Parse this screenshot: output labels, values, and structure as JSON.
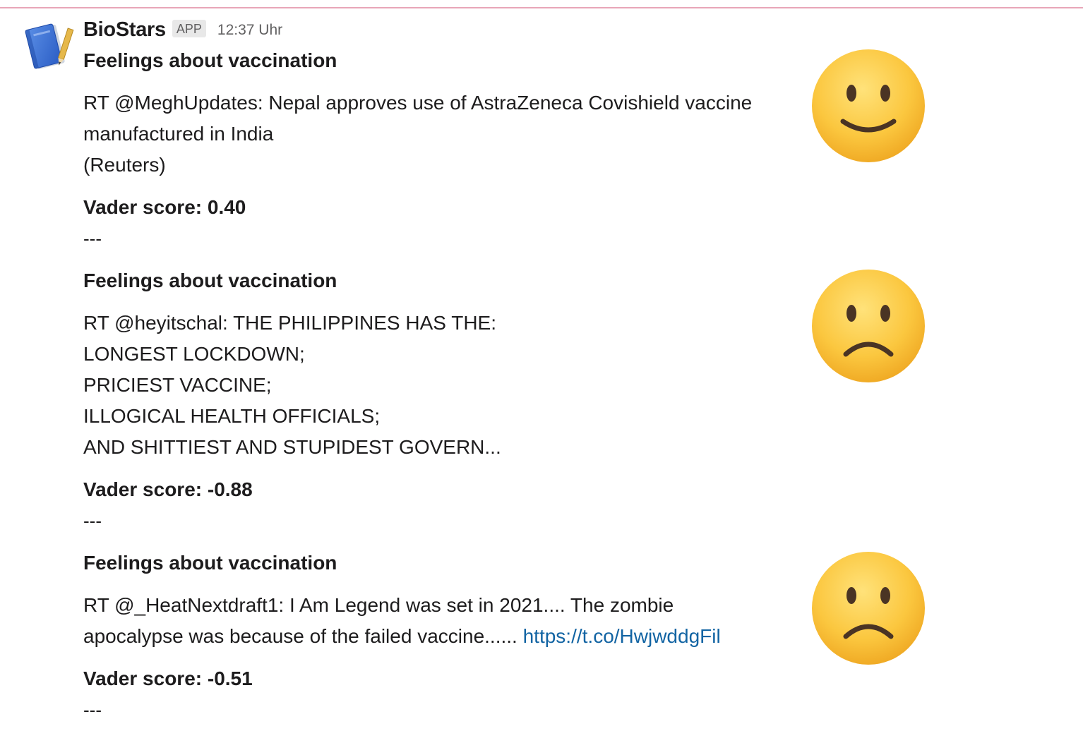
{
  "header": {
    "app_name": "BioStars",
    "badge": "APP",
    "timestamp": "12:37 Uhr"
  },
  "messages": [
    {
      "title": "Feelings about vaccination",
      "lines": [
        "RT @MeghUpdates: Nepal approves use of AstraZeneca Covishield vaccine",
        "manufactured in India",
        "(Reuters)"
      ],
      "score": "Vader score: 0.40",
      "separator": "---",
      "emoji": "slightly-smiling-face-icon"
    },
    {
      "title": "Feelings about vaccination",
      "lines": [
        "RT @heyitschal: THE PHILIPPINES HAS THE:",
        "LONGEST LOCKDOWN;",
        "PRICIEST VACCINE;",
        "ILLOGICAL HEALTH OFFICIALS;",
        "AND SHITTIEST AND STUPIDEST GOVERN..."
      ],
      "score": "Vader score: -0.88",
      "separator": "---",
      "emoji": "frowning-face-icon"
    },
    {
      "title": "Feelings about vaccination",
      "lines": [
        "RT @_HeatNextdraft1: I Am Legend was set in 2021.... The zombie",
        "apocalypse was because of the failed vaccine......"
      ],
      "link": "https://t.co/HwjwddgFil",
      "score": "Vader score: -0.51",
      "separator": "---",
      "emoji": "frowning-face-icon"
    }
  ],
  "colors": {
    "link": "#1264a3",
    "divider": "#e8a6b8",
    "text": "#1d1c1d",
    "muted": "#616061"
  }
}
